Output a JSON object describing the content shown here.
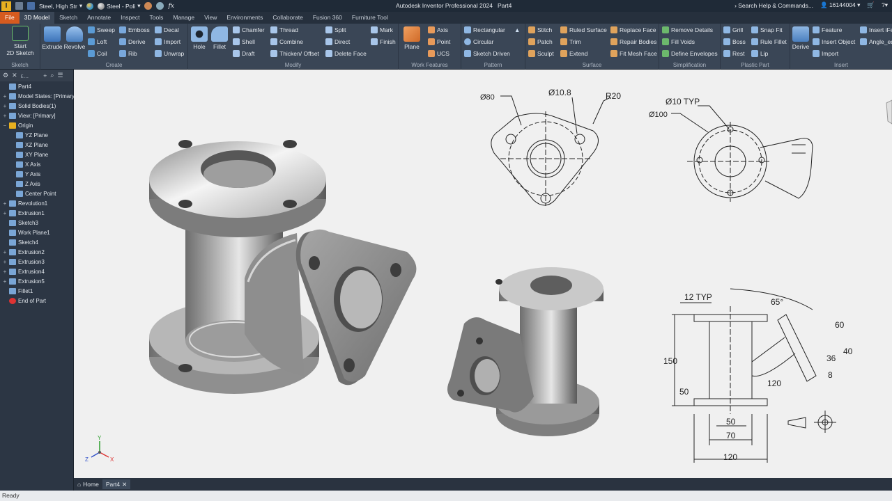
{
  "titlebar": {
    "material": "Steel, High Str",
    "appearance": "Steel - Poli",
    "title": "Autodesk Inventor Professional 2024",
    "doc": "Part4",
    "search": "Search Help & Commands...",
    "user": "16144004"
  },
  "tabs": [
    "File",
    "3D Model",
    "Sketch",
    "Annotate",
    "Inspect",
    "Tools",
    "Manage",
    "View",
    "Environments",
    "Collaborate",
    "Fusion 360",
    "Furniture Tool"
  ],
  "ribbon": {
    "sketch": {
      "panel": "Sketch",
      "start": "Start",
      "start2": "2D Sketch"
    },
    "create": {
      "panel": "Create",
      "extrude": "Extrude",
      "revolve": "Revolve",
      "sweep": "Sweep",
      "loft": "Loft",
      "coil": "Coil",
      "emboss": "Emboss",
      "derive": "Derive",
      "rib": "Rib",
      "decal": "Decal",
      "import": "Import",
      "unwrap": "Unwrap"
    },
    "modify": {
      "panel": "Modify",
      "hole": "Hole",
      "fillet": "Fillet",
      "chamfer": "Chamfer",
      "shell": "Shell",
      "draft": "Draft",
      "thread": "Thread",
      "combine": "Combine",
      "thicken": "Thicken/ Offset",
      "split": "Split",
      "direct": "Direct",
      "deleteface": "Delete Face",
      "mark": "Mark",
      "finish": "Finish"
    },
    "work": {
      "panel": "Work Features",
      "plane": "Plane",
      "axis": "Axis",
      "point": "Point",
      "ucs": "UCS"
    },
    "pattern": {
      "panel": "Pattern",
      "rect": "Rectangular",
      "circ": "Circular",
      "sketchdriven": "Sketch Driven"
    },
    "surface": {
      "panel": "Surface",
      "stitch": "Stitch",
      "patch": "Patch",
      "sculpt": "Sculpt",
      "ruled": "Ruled Surface",
      "trim": "Trim",
      "extend": "Extend",
      "replace": "Replace Face",
      "repair": "Repair Bodies",
      "fitmesh": "Fit Mesh Face"
    },
    "simplification": {
      "panel": "Simplification",
      "remove": "Remove Details",
      "fillvoids": "Fill Voids",
      "envelopes": "Define Envelopes"
    },
    "plastic": {
      "panel": "Plastic Part",
      "grill": "Grill",
      "boss": "Boss",
      "rest": "Rest",
      "snapfit": "Snap Fit",
      "rulefillet": "Rule Fillet",
      "lip": "Lip"
    },
    "insert": {
      "panel": "Insert",
      "derive": "Derive",
      "feature": "Feature",
      "insertobj": "Insert Object",
      "import": "Import",
      "insertife": "Insert iFe",
      "angle": "Angle_eq"
    }
  },
  "browser": {
    "items": [
      {
        "label": "Part4",
        "pm": ""
      },
      {
        "label": "Model States: [Primary]",
        "pm": "+"
      },
      {
        "label": "Solid Bodies(1)",
        "pm": "+"
      },
      {
        "label": "View: [Primary]",
        "pm": "+"
      },
      {
        "label": "Origin",
        "pm": "−"
      },
      {
        "label": "YZ Plane",
        "pm": ""
      },
      {
        "label": "XZ Plane",
        "pm": ""
      },
      {
        "label": "XY Plane",
        "pm": ""
      },
      {
        "label": "X Axis",
        "pm": ""
      },
      {
        "label": "Y Axis",
        "pm": ""
      },
      {
        "label": "Z Axis",
        "pm": ""
      },
      {
        "label": "Center Point",
        "pm": ""
      },
      {
        "label": "Revolution1",
        "pm": "+"
      },
      {
        "label": "Extrusion1",
        "pm": "+"
      },
      {
        "label": "Sketch3",
        "pm": ""
      },
      {
        "label": "Work Plane1",
        "pm": ""
      },
      {
        "label": "Sketch4",
        "pm": ""
      },
      {
        "label": "Extrusion2",
        "pm": "+"
      },
      {
        "label": "Extrusion3",
        "pm": "+"
      },
      {
        "label": "Extrusion4",
        "pm": "+"
      },
      {
        "label": "Extrusion5",
        "pm": "+"
      },
      {
        "label": "Fillet1",
        "pm": ""
      },
      {
        "label": "End of Part",
        "pm": ""
      }
    ]
  },
  "drawing": {
    "d80": "Ø80",
    "d108": "Ø10.8",
    "r20": "R20",
    "d10typ": "Ø10 TYP",
    "d100": "Ø100",
    "typ12": "12 TYP",
    "a65": "65°",
    "h150": "150",
    "h50": "50",
    "w50": "50",
    "w70": "70",
    "w120": "120",
    "s60": "60",
    "s40": "40",
    "s36": "36",
    "s8": "8",
    "s120": "120"
  },
  "axes": {
    "y": "Y",
    "z": "Z",
    "x": "X"
  },
  "doctabs": {
    "home": "Home",
    "part": "Part4"
  },
  "status": "Ready"
}
